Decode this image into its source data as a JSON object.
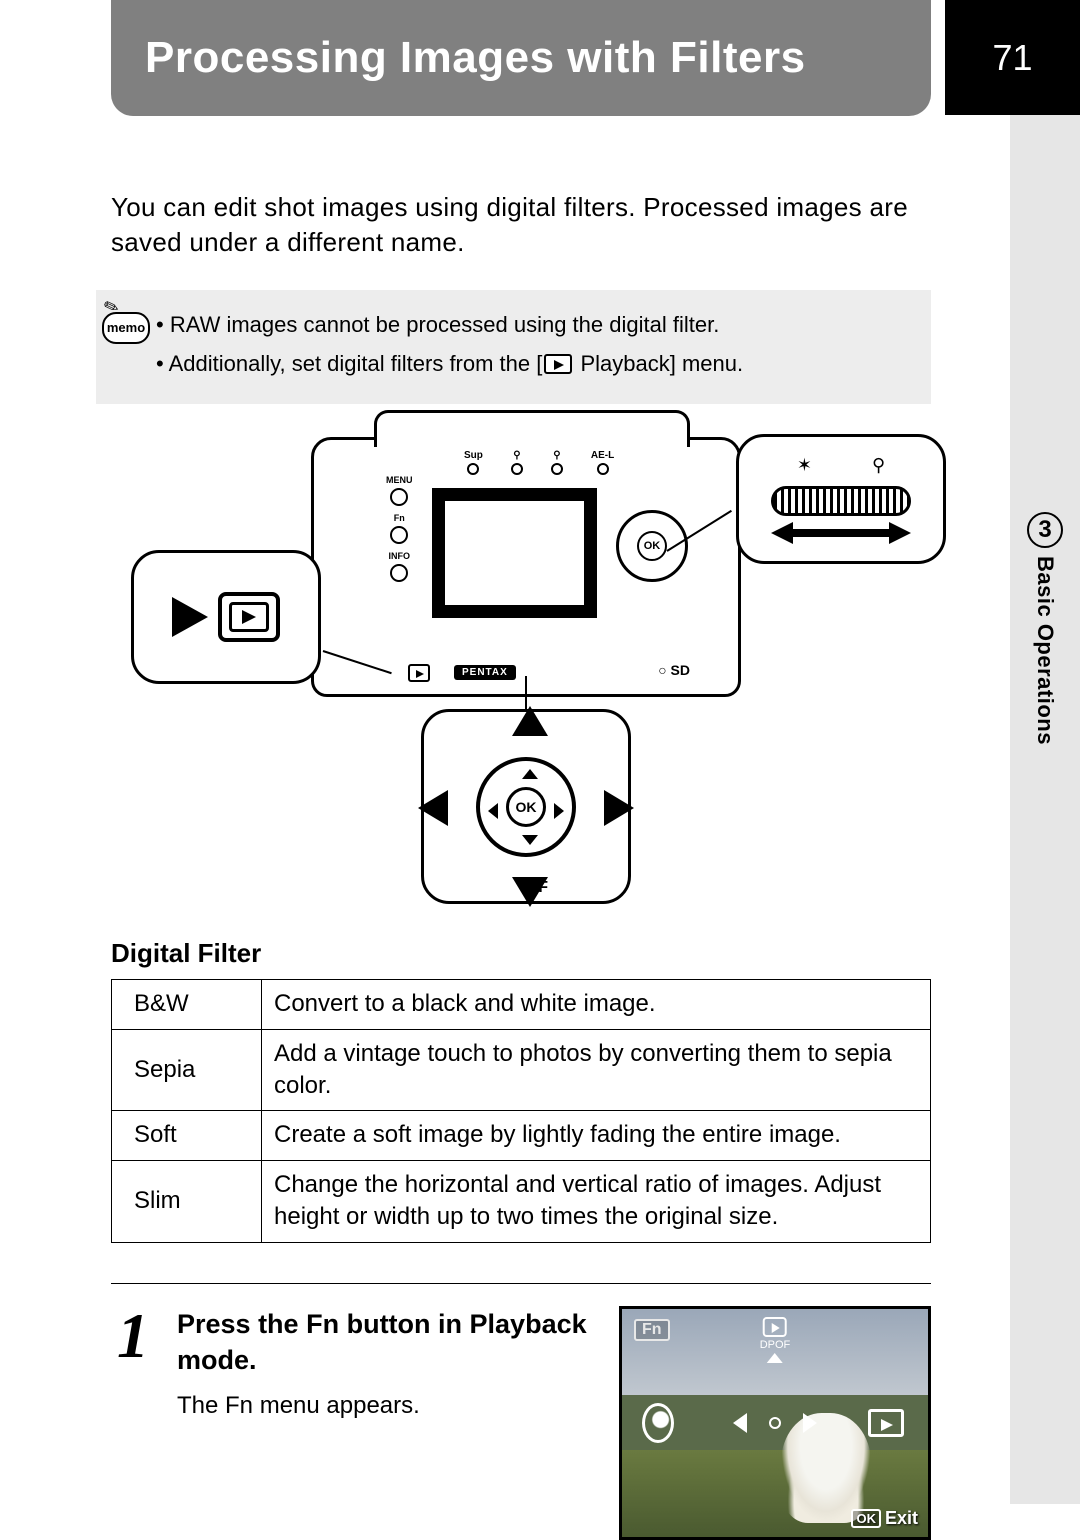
{
  "page_number": "71",
  "side_tab": {
    "chapter_number": "3",
    "chapter_title": "Basic Operations"
  },
  "title": "Processing Images with Filters",
  "intro": "You can edit shot images using digital filters. Processed images are saved under a different name.",
  "memo": {
    "label": "memo",
    "items": [
      "RAW images cannot be processed using the digital filter.",
      {
        "pre": "Additionally, set digital filters from the [",
        "post": " Playback] menu."
      }
    ]
  },
  "diagram": {
    "brand": "PENTAX",
    "ok": "OK",
    "top_labels": [
      "Sup",
      "",
      "",
      "AE-L"
    ],
    "side_labels": [
      "MENU",
      "Fn",
      "INFO"
    ],
    "sd": "SD",
    "fn_label": "F",
    "callout_top_icons": [
      "✶",
      "⚲"
    ]
  },
  "filter_section": {
    "heading": "Digital Filter",
    "rows": [
      {
        "name": "B&W",
        "desc": "Convert to a black and white image."
      },
      {
        "name": "Sepia",
        "desc": "Add a vintage touch to photos by converting them to sepia color."
      },
      {
        "name": "Soft",
        "desc": "Create a soft image by lightly fading the entire image."
      },
      {
        "name": "Slim",
        "desc": "Change the horizontal and vertical ratio of images. Adjust height or width up to two times the original size."
      }
    ]
  },
  "step": {
    "number": "1",
    "title_pre": "Press the ",
    "title_fn": "Fn",
    "title_post": " button in Playback mode.",
    "body": "The Fn menu appears."
  },
  "lcd": {
    "fn": "Fn",
    "dpof": "DPOF",
    "ok": "OK",
    "exit": "Exit"
  }
}
